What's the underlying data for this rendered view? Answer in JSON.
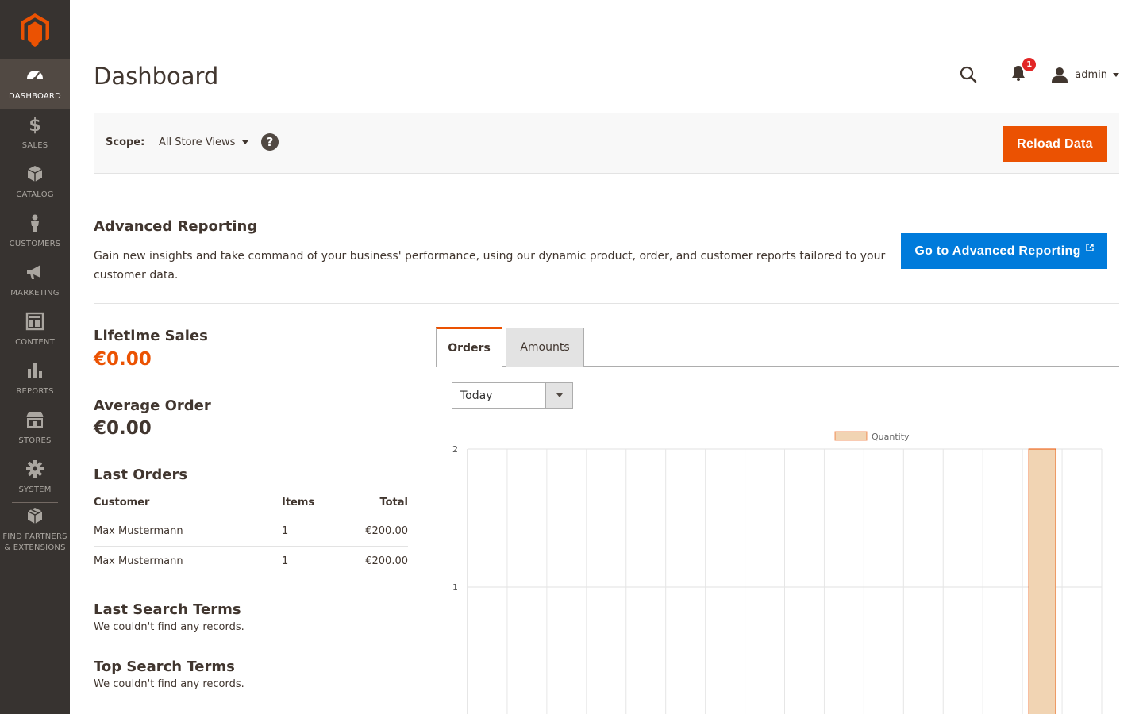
{
  "sidebar": {
    "items": [
      {
        "label": "DASHBOARD",
        "icon": "dashboard-icon"
      },
      {
        "label": "SALES",
        "icon": "dollar-icon"
      },
      {
        "label": "CATALOG",
        "icon": "box-icon"
      },
      {
        "label": "CUSTOMERS",
        "icon": "person-icon"
      },
      {
        "label": "MARKETING",
        "icon": "megaphone-icon"
      },
      {
        "label": "CONTENT",
        "icon": "layout-icon"
      },
      {
        "label": "REPORTS",
        "icon": "bar-chart-icon"
      },
      {
        "label": "STORES",
        "icon": "store-icon"
      },
      {
        "label": "SYSTEM",
        "icon": "gear-icon"
      }
    ],
    "extra_item": {
      "label_line1": "FIND PARTNERS",
      "label_line2": "& EXTENSIONS",
      "icon": "boxes-icon"
    }
  },
  "header": {
    "title": "Dashboard",
    "notification_count": "1",
    "user": "admin"
  },
  "scope": {
    "label": "Scope:",
    "value": "All Store Views",
    "help": "?",
    "reload_label": "Reload Data"
  },
  "advanced": {
    "title": "Advanced Reporting",
    "description": "Gain new insights and take command of your business' performance, using our dynamic product, order, and customer reports tailored to your customer data.",
    "button_label": "Go to Advanced Reporting"
  },
  "stats": {
    "lifetime_label": "Lifetime Sales",
    "lifetime_value": "€0.00",
    "average_label": "Average Order",
    "average_value": "€0.00"
  },
  "last_orders": {
    "title": "Last Orders",
    "columns": [
      "Customer",
      "Items",
      "Total"
    ],
    "rows": [
      {
        "customer": "Max Mustermann",
        "items": "1",
        "total": "€200.00"
      },
      {
        "customer": "Max Mustermann",
        "items": "1",
        "total": "€200.00"
      }
    ]
  },
  "last_search": {
    "title": "Last Search Terms",
    "empty": "We couldn't find any records."
  },
  "top_search": {
    "title": "Top Search Terms",
    "empty": "We couldn't find any records."
  },
  "tabs": {
    "orders": "Orders",
    "amounts": "Amounts"
  },
  "period": {
    "value": "Today"
  },
  "colors": {
    "accent": "#eb5202",
    "blue": "#007bdb",
    "sidebar": "#373330",
    "bar_fill": "#f1d4b3",
    "bar_stroke": "#eb5202"
  },
  "chart_data": {
    "type": "bar",
    "legend": [
      "Quantity"
    ],
    "y_ticks": [
      "2",
      "1"
    ],
    "ylim": [
      0,
      2
    ],
    "series": [
      {
        "name": "Quantity",
        "values": [
          0,
          0,
          0,
          0,
          0,
          0,
          0,
          0,
          0,
          0,
          0,
          0,
          0,
          0,
          2,
          0
        ]
      }
    ],
    "grid": true,
    "legend_position": "top"
  }
}
